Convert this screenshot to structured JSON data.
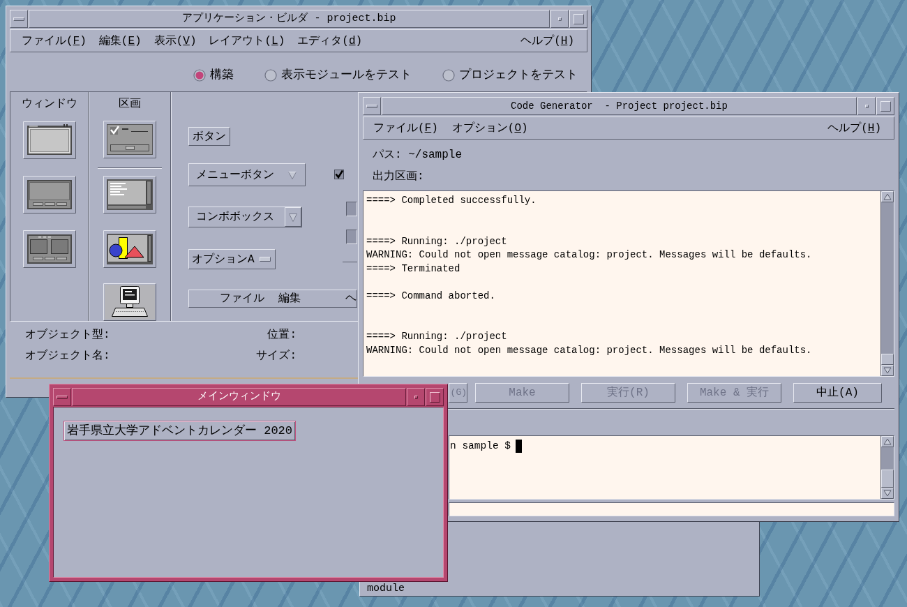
{
  "app_builder": {
    "title": "アプリケーション・ビルダ - project.bip",
    "menu": [
      "ファイル(F)",
      "編集(E)",
      "表示(V)",
      "レイアウト(L)",
      "エディタ(d)"
    ],
    "help_menu": "ヘルプ(H)",
    "modes": [
      {
        "label": "構築",
        "selected": true
      },
      {
        "label": "表示モジュールをテスト",
        "selected": false
      },
      {
        "label": "プロジェクトをテスト",
        "selected": false
      }
    ],
    "palette": {
      "window_header": "ウィンドウ",
      "pane_header": "区画",
      "button": "ボタン",
      "menu_button": "メニューボタン",
      "checkbox": {
        "checked": true
      },
      "combo_box": "コンボボックス",
      "option_menu": "オプションA",
      "menubar": [
        "ファイル",
        "編集"
      ],
      "menubar_help": "ヘ"
    },
    "info": {
      "object_type": "オブジェクト型:",
      "position": "位置:",
      "object_name": "オブジェクト名:",
      "size": "サイズ:"
    }
  },
  "code_generator": {
    "title": "Code Generator  - Project project.bip",
    "menu": [
      "ファイル(F)",
      "オプション(O)"
    ],
    "help_menu": "ヘルプ(H)",
    "path": "パス: ~/sample",
    "output_label": "出力区画:",
    "output_log": "====> Completed successfully.\n\n\n====> Running: ./project\nWARNING: Could not open message catalog: project. Messages will be defaults.\n====> Terminated\n\n====> Command aborted.\n\n\n====> Running: ./project\nWARNING: Could not open message catalog: project. Messages will be defaults.",
    "buttons": [
      {
        "label": "(G)",
        "disabled": true
      },
      {
        "label": "Make",
        "disabled": true
      },
      {
        "label": "実行(R)",
        "disabled": true
      },
      {
        "label": "Make & 実行",
        "disabled": true
      },
      {
        "label": "中止(A)",
        "disabled": false
      }
    ],
    "terminal_text": "n sample $"
  },
  "main_window": {
    "title": "メインウィンドウ",
    "button": "岩手県立大学アドベントカレンダー 2020"
  },
  "background_window": {
    "text": "module"
  }
}
